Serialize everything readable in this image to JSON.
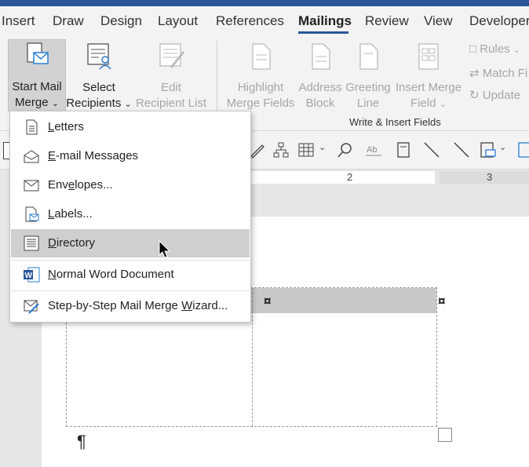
{
  "tabs": [
    {
      "label": "Insert"
    },
    {
      "label": "Draw"
    },
    {
      "label": "Design"
    },
    {
      "label": "Layout"
    },
    {
      "label": "References"
    },
    {
      "label": "Mailings",
      "active": true
    },
    {
      "label": "Review"
    },
    {
      "label": "View"
    },
    {
      "label": "Developer"
    }
  ],
  "ribbon": {
    "start_mail_merge": {
      "line1": "Start Mail",
      "line2": "Merge",
      "icon": "envelope-page-icon"
    },
    "select_recipients": {
      "line1": "Select",
      "line2": "Recipients",
      "icon": "recipients-list-icon"
    },
    "edit_recipient_list": {
      "line1": "Edit",
      "line2": "Recipient List",
      "icon": "edit-list-icon"
    },
    "highlight_merge_fields": {
      "line1": "Highlight",
      "line2": "Merge Fields",
      "icon": "highlight-fields-icon"
    },
    "address_block": {
      "line1": "Address",
      "line2": "Block",
      "icon": "address-block-icon"
    },
    "greeting_line": {
      "line1": "Greeting",
      "line2": "Line",
      "icon": "greeting-line-icon"
    },
    "insert_merge_field": {
      "line1": "Insert Merge",
      "line2": "Field",
      "icon": "insert-field-icon"
    },
    "rules": {
      "label": "Rules"
    },
    "match_fields": {
      "label": "Match Fi"
    },
    "update": {
      "label": "Update"
    },
    "group_label": "Write & Insert Fields",
    "colors": {
      "accent": "#2b579a",
      "disabled": "#a6a6a6"
    }
  },
  "ruler": {
    "mark1": "2",
    "mark2": "3"
  },
  "menu": {
    "items": [
      {
        "pre": "",
        "u": "L",
        "post": "etters",
        "icon": "letter-page-icon"
      },
      {
        "pre": "",
        "u": "E",
        "post": "-mail Messages",
        "icon": "email-envelope-icon"
      },
      {
        "pre": "Env",
        "u": "e",
        "post": "lopes...",
        "icon": "envelope-icon"
      },
      {
        "pre": "",
        "u": "L",
        "post": "abels...",
        "icon": "labels-icon"
      },
      {
        "pre": "",
        "u": "D",
        "post": "irectory",
        "icon": "directory-icon",
        "highlighted": true
      },
      {
        "pre": "",
        "u": "N",
        "post": "ormal Word Document",
        "icon": "word-icon"
      },
      {
        "pre": "Step-by-Step Mail Merge ",
        "u": "W",
        "post": "izard...",
        "icon": "wizard-icon"
      }
    ]
  },
  "document": {
    "pilcrow": "¶",
    "cell_mark": "¤"
  }
}
